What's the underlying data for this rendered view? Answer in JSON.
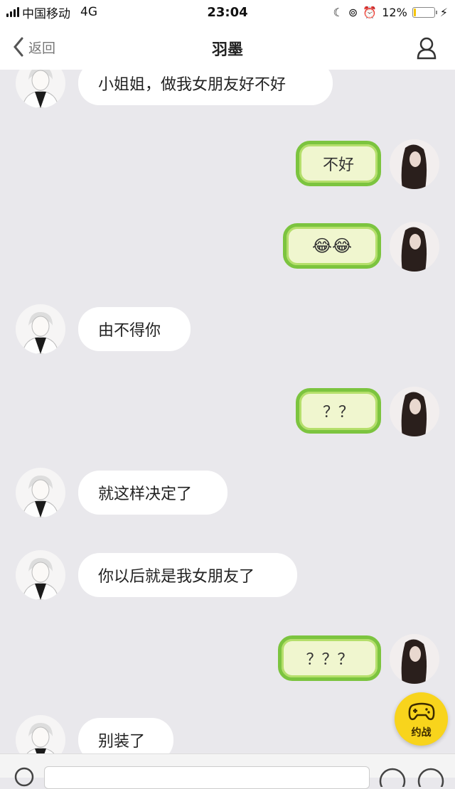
{
  "status_bar": {
    "carrier": "中国移动",
    "network": "4G",
    "time": "23:04",
    "battery_percent": "12%",
    "battery_level": 0.12
  },
  "nav": {
    "back_label": "返回",
    "title": "羽墨"
  },
  "messages": [
    {
      "side": "left",
      "text": "小姐姐，做我女朋友好不好"
    },
    {
      "side": "right",
      "text": "不好"
    },
    {
      "side": "right",
      "text": "😂😂"
    },
    {
      "side": "left",
      "text": "由不得你"
    },
    {
      "side": "right",
      "text": "？？"
    },
    {
      "side": "left",
      "text": "就这样决定了"
    },
    {
      "side": "left",
      "text": "你以后就是我女朋友了"
    },
    {
      "side": "right",
      "text": "？？？"
    },
    {
      "side": "left",
      "text": "别装了"
    }
  ],
  "fab": {
    "label": "约战",
    "icon": "gamepad-icon"
  },
  "colors": {
    "accent_green": "#7cc43f",
    "fab_yellow": "#f8d41c",
    "background": "#e9e8ec"
  }
}
